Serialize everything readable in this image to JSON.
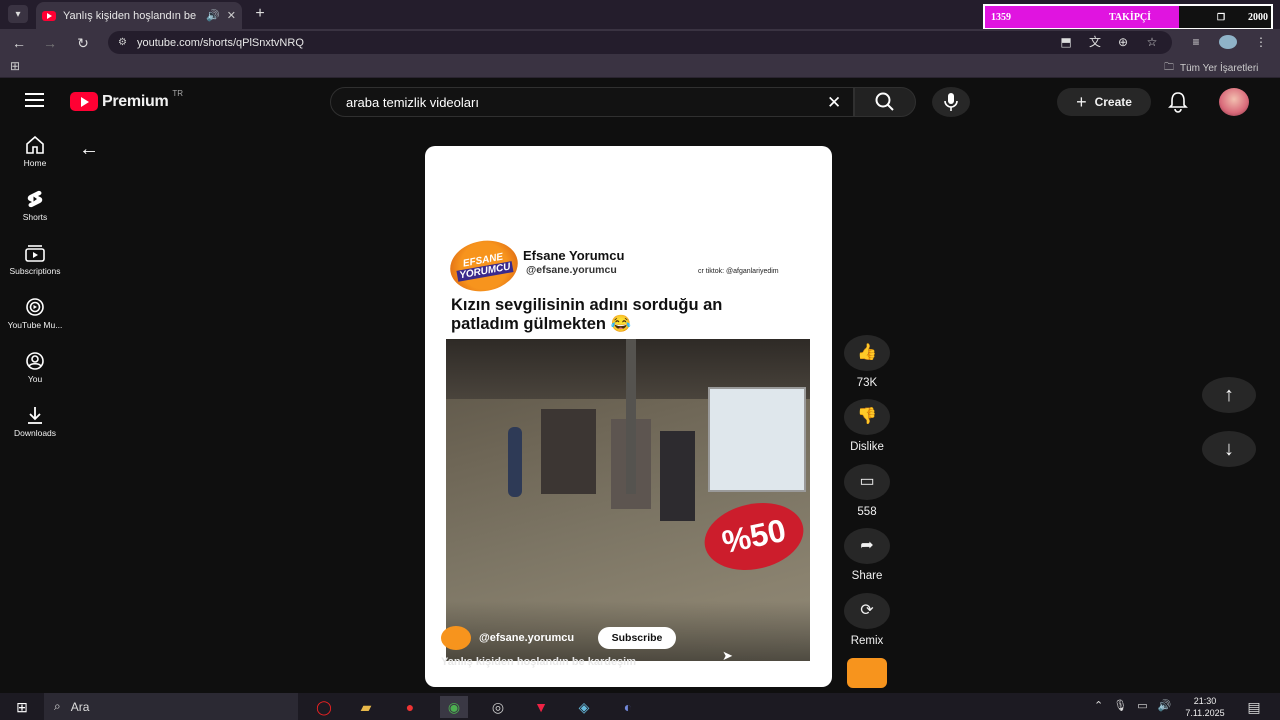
{
  "browser": {
    "tab_title": "Yanlış kişiden hoşlandın be",
    "url": "youtube.com/shorts/qPlSnxtvNRQ",
    "bookmarks_label": "Tüm Yer İşaretleri"
  },
  "overlay_counter": {
    "current": "1359",
    "label": "TAKİPÇİ",
    "goal": "2000",
    "progress": 0.68,
    "fill_color": "#e014e0"
  },
  "header": {
    "logo_text": "Premium",
    "region": "TR",
    "search_value": "araba temizlik videoları",
    "create_label": "Create"
  },
  "guide": {
    "items": [
      {
        "label": "Home",
        "icon": "home-icon"
      },
      {
        "label": "Shorts",
        "icon": "shorts-icon"
      },
      {
        "label": "Subscriptions",
        "icon": "subscriptions-icon"
      },
      {
        "label": "YouTube Mu...",
        "icon": "youtube-music-icon"
      },
      {
        "label": "You",
        "icon": "you-icon"
      },
      {
        "label": "Downloads",
        "icon": "downloads-icon"
      }
    ]
  },
  "short": {
    "post_channel": "Efsane Yorumcu",
    "post_handle": "@efsane.yorumcu",
    "post_credit": "cr tiktok: @afganlariyedim",
    "logo_line1": "EFSANE",
    "logo_line2": "YORUMCU",
    "post_caption": "Kızın sevgilisinin adını sorduğu an patladım gülmekten 😂",
    "sale_sign": "%50",
    "channel_handle": "@efsane.yorumcu",
    "subscribe_label": "Subscribe",
    "title": "Yanlış kişiden hoşlandın be kardeşim"
  },
  "actions": {
    "likes": "73K",
    "dislike_label": "Dislike",
    "comments": "558",
    "share_label": "Share",
    "remix_label": "Remix"
  },
  "taskbar": {
    "search_placeholder": "Ara",
    "time": "21:30",
    "date": "7.11.2025"
  }
}
